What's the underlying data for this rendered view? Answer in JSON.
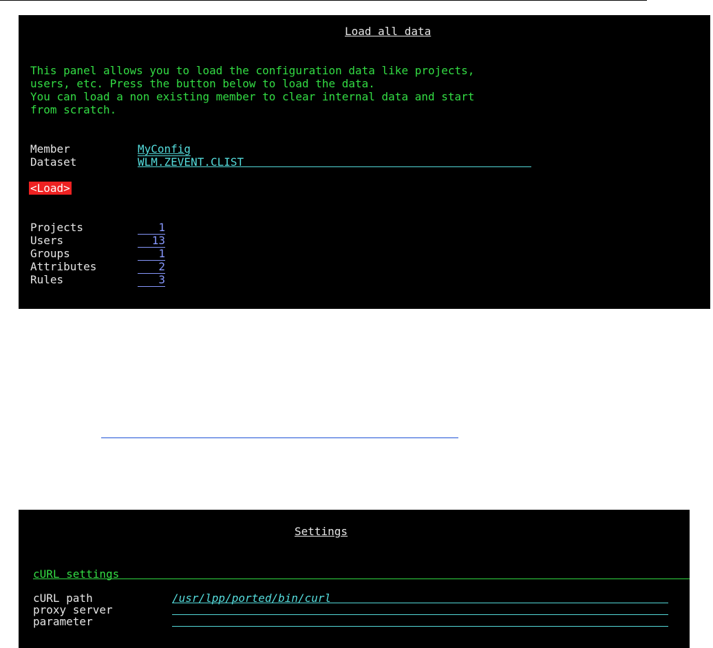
{
  "load_panel": {
    "title": "Load all data",
    "description": [
      "This panel allows you to load the configuration data like projects,",
      "users, etc. Press the button below to load the data.",
      "You can load a non existing member to clear internal data and start",
      "from scratch."
    ],
    "member_label": "Member",
    "member_value": "MyConfig",
    "dataset_label": "Dataset",
    "dataset_value": "WLM.ZEVENT.CLIST",
    "load_button": "<Load>",
    "stats": [
      {
        "label": "Projects",
        "value": "1"
      },
      {
        "label": "Users",
        "value": "13"
      },
      {
        "label": "Groups",
        "value": "1"
      },
      {
        "label": "Attributes",
        "value": "2"
      },
      {
        "label": "Rules",
        "value": "3"
      }
    ]
  },
  "settings_panel": {
    "title": "Settings",
    "section": "cURL settings",
    "fields": [
      {
        "label": "cURL path",
        "value": "/usr/lpp/ported/bin/curl"
      },
      {
        "label": "proxy server",
        "value": ""
      },
      {
        "label": "parameter",
        "value": ""
      }
    ]
  },
  "colors": {
    "background": "#000000",
    "text_green": "#33dd44",
    "field_cyan": "#55dddd",
    "number_blue": "#8899ff",
    "button_red": "#ee2222"
  }
}
